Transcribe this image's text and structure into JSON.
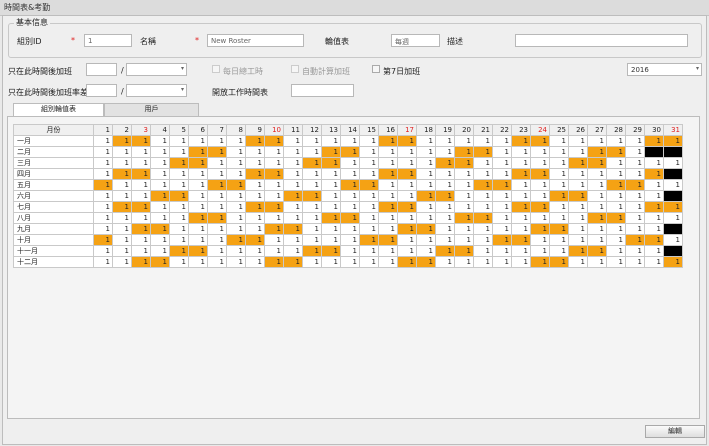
{
  "window": {
    "title": "時間表&考勤"
  },
  "basic": {
    "group_title": "基本信息",
    "group_id_label": "組別ID",
    "group_id_value": "1",
    "name_label": "名稱",
    "name_value": "New Roster",
    "roster_label": "輪值表",
    "roster_value": "每週",
    "desc_label": "描述",
    "desc_value": ""
  },
  "options": {
    "ot_after_label": "只在此時間後加班",
    "ot_rate_label": "只在此時間後加班率差",
    "slash": "/",
    "daily_label": "每日總工時",
    "auto_label": "自動計算加班",
    "day7_label": "第7日加班",
    "open_label": "開放工作時間表",
    "year_value": "2016"
  },
  "tabs": [
    {
      "label": "組別輪值表"
    },
    {
      "label": "用戶"
    }
  ],
  "calendar": {
    "month_header": "月份",
    "days": [
      "1",
      "2",
      "3",
      "4",
      "5",
      "6",
      "7",
      "8",
      "9",
      "10",
      "11",
      "12",
      "13",
      "14",
      "15",
      "16",
      "17",
      "18",
      "19",
      "20",
      "21",
      "22",
      "23",
      "24",
      "25",
      "26",
      "27",
      "28",
      "29",
      "30",
      "31"
    ],
    "red_days": [
      3,
      10,
      17,
      24,
      31
    ],
    "rows": [
      {
        "month": "一月",
        "cells": [
          "w",
          "o",
          "o",
          "w",
          "w",
          "w",
          "w",
          "w",
          "o",
          "o",
          "w",
          "w",
          "w",
          "w",
          "w",
          "o",
          "o",
          "w",
          "w",
          "w",
          "w",
          "w",
          "o",
          "o",
          "w",
          "w",
          "w",
          "w",
          "w",
          "o",
          "o"
        ]
      },
      {
        "month": "二月",
        "cells": [
          "w",
          "w",
          "w",
          "w",
          "w",
          "o",
          "o",
          "w",
          "w",
          "w",
          "w",
          "w",
          "o",
          "o",
          "w",
          "w",
          "w",
          "w",
          "w",
          "o",
          "o",
          "w",
          "w",
          "w",
          "w",
          "w",
          "o",
          "o",
          "w",
          "b",
          "b"
        ]
      },
      {
        "month": "三月",
        "cells": [
          "w",
          "w",
          "w",
          "w",
          "o",
          "o",
          "w",
          "w",
          "w",
          "w",
          "w",
          "o",
          "o",
          "w",
          "w",
          "w",
          "w",
          "w",
          "o",
          "o",
          "w",
          "w",
          "w",
          "w",
          "w",
          "o",
          "o",
          "w",
          "w",
          "w",
          "w"
        ]
      },
      {
        "month": "四月",
        "cells": [
          "w",
          "o",
          "o",
          "w",
          "w",
          "w",
          "w",
          "w",
          "o",
          "o",
          "w",
          "w",
          "w",
          "w",
          "w",
          "o",
          "o",
          "w",
          "w",
          "w",
          "w",
          "w",
          "o",
          "o",
          "w",
          "w",
          "w",
          "w",
          "w",
          "o",
          "b"
        ]
      },
      {
        "month": "五月",
        "cells": [
          "o",
          "w",
          "w",
          "w",
          "w",
          "w",
          "o",
          "o",
          "w",
          "w",
          "w",
          "w",
          "w",
          "o",
          "o",
          "w",
          "w",
          "w",
          "w",
          "w",
          "o",
          "o",
          "w",
          "w",
          "w",
          "w",
          "w",
          "o",
          "o",
          "w",
          "w"
        ]
      },
      {
        "month": "六月",
        "cells": [
          "w",
          "w",
          "w",
          "o",
          "o",
          "w",
          "w",
          "w",
          "w",
          "w",
          "o",
          "o",
          "w",
          "w",
          "w",
          "w",
          "w",
          "o",
          "o",
          "w",
          "w",
          "w",
          "w",
          "w",
          "o",
          "o",
          "w",
          "w",
          "w",
          "w",
          "b"
        ]
      },
      {
        "month": "七月",
        "cells": [
          "w",
          "o",
          "o",
          "w",
          "w",
          "w",
          "w",
          "w",
          "o",
          "o",
          "w",
          "w",
          "w",
          "w",
          "w",
          "o",
          "o",
          "w",
          "w",
          "w",
          "w",
          "w",
          "o",
          "o",
          "w",
          "w",
          "w",
          "w",
          "w",
          "o",
          "o"
        ]
      },
      {
        "month": "八月",
        "cells": [
          "w",
          "w",
          "w",
          "w",
          "w",
          "o",
          "o",
          "w",
          "w",
          "w",
          "w",
          "w",
          "o",
          "o",
          "w",
          "w",
          "w",
          "w",
          "w",
          "o",
          "o",
          "w",
          "w",
          "w",
          "w",
          "w",
          "o",
          "o",
          "w",
          "w",
          "w"
        ]
      },
      {
        "month": "九月",
        "cells": [
          "w",
          "w",
          "o",
          "o",
          "w",
          "w",
          "w",
          "w",
          "w",
          "o",
          "o",
          "w",
          "w",
          "w",
          "w",
          "w",
          "o",
          "o",
          "w",
          "w",
          "w",
          "w",
          "w",
          "o",
          "o",
          "w",
          "w",
          "w",
          "w",
          "w",
          "b"
        ]
      },
      {
        "month": "十月",
        "cells": [
          "o",
          "w",
          "w",
          "w",
          "w",
          "w",
          "w",
          "o",
          "o",
          "w",
          "w",
          "w",
          "w",
          "w",
          "o",
          "o",
          "w",
          "w",
          "w",
          "w",
          "w",
          "o",
          "o",
          "w",
          "w",
          "w",
          "w",
          "w",
          "o",
          "o",
          "w"
        ]
      },
      {
        "month": "十一月",
        "cells": [
          "w",
          "w",
          "w",
          "w",
          "o",
          "o",
          "w",
          "w",
          "w",
          "w",
          "w",
          "o",
          "o",
          "w",
          "w",
          "w",
          "w",
          "w",
          "o",
          "o",
          "w",
          "w",
          "w",
          "w",
          "w",
          "o",
          "o",
          "w",
          "w",
          "w",
          "b"
        ]
      },
      {
        "month": "十二月",
        "cells": [
          "w",
          "w",
          "o",
          "o",
          "w",
          "w",
          "w",
          "w",
          "w",
          "o",
          "o",
          "w",
          "w",
          "w",
          "w",
          "w",
          "o",
          "o",
          "w",
          "w",
          "w",
          "w",
          "w",
          "o",
          "o",
          "w",
          "w",
          "w",
          "w",
          "w",
          "o"
        ]
      }
    ]
  },
  "footer": {
    "edit_label": "編輯"
  },
  "colors": {
    "accent": "#f5a214",
    "blocked": "#000000",
    "weekend_text": "#e02020"
  }
}
